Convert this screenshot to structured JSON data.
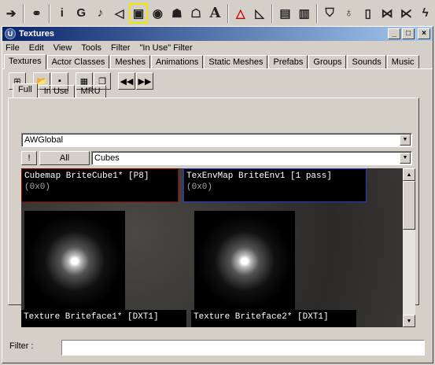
{
  "toolbar_top": {
    "icons": [
      "arrow-right-icon",
      "binoculars-icon",
      "info-icon",
      "g-icon",
      "music-icon",
      "sound-icon",
      "texture-browser-icon",
      "eye-icon",
      "mesh-icon",
      "static-mesh-icon",
      "font-icon",
      "triangle-icon",
      "terrain-icon",
      "actor-props-icon",
      "group-props-icon",
      "shield-icon",
      "light-icon",
      "pillar-icon",
      "path-icon",
      "path-alt-icon",
      "bolt-icon"
    ],
    "glyphs": {
      "i": "i",
      "g": "G",
      "a": "A"
    }
  },
  "window": {
    "title": "Textures",
    "title_icon": "U",
    "minimize": "_",
    "maximize": "□",
    "close": "×"
  },
  "menu": [
    "File",
    "Edit",
    "View",
    "Tools",
    "Filter",
    "\"In Use\" Filter"
  ],
  "main_tabs": [
    "Textures",
    "Actor Classes",
    "Meshes",
    "Animations",
    "Static Meshes",
    "Prefabs",
    "Groups",
    "Sounds",
    "Music"
  ],
  "active_main_tab": "Textures",
  "sub_tabs": [
    "Full",
    "In Use",
    "MRU"
  ],
  "active_sub_tab": "Full",
  "package_combo": {
    "value": "AWGlobal"
  },
  "toggle_button": "!",
  "all_button": "All",
  "group_combo": {
    "value": "Cubes"
  },
  "tiles": [
    {
      "name": "Cubemap BriteCube1* [P8]",
      "size": "(0x0)"
    },
    {
      "name": "TexEnvMap BriteEnv1 [1 pass]",
      "size": "(0x0)"
    },
    {
      "name": "Texture Briteface1* [DXT1]"
    },
    {
      "name": "Texture Briteface2* [DXT1]"
    }
  ],
  "filter": {
    "label": "Filter :",
    "value": ""
  }
}
